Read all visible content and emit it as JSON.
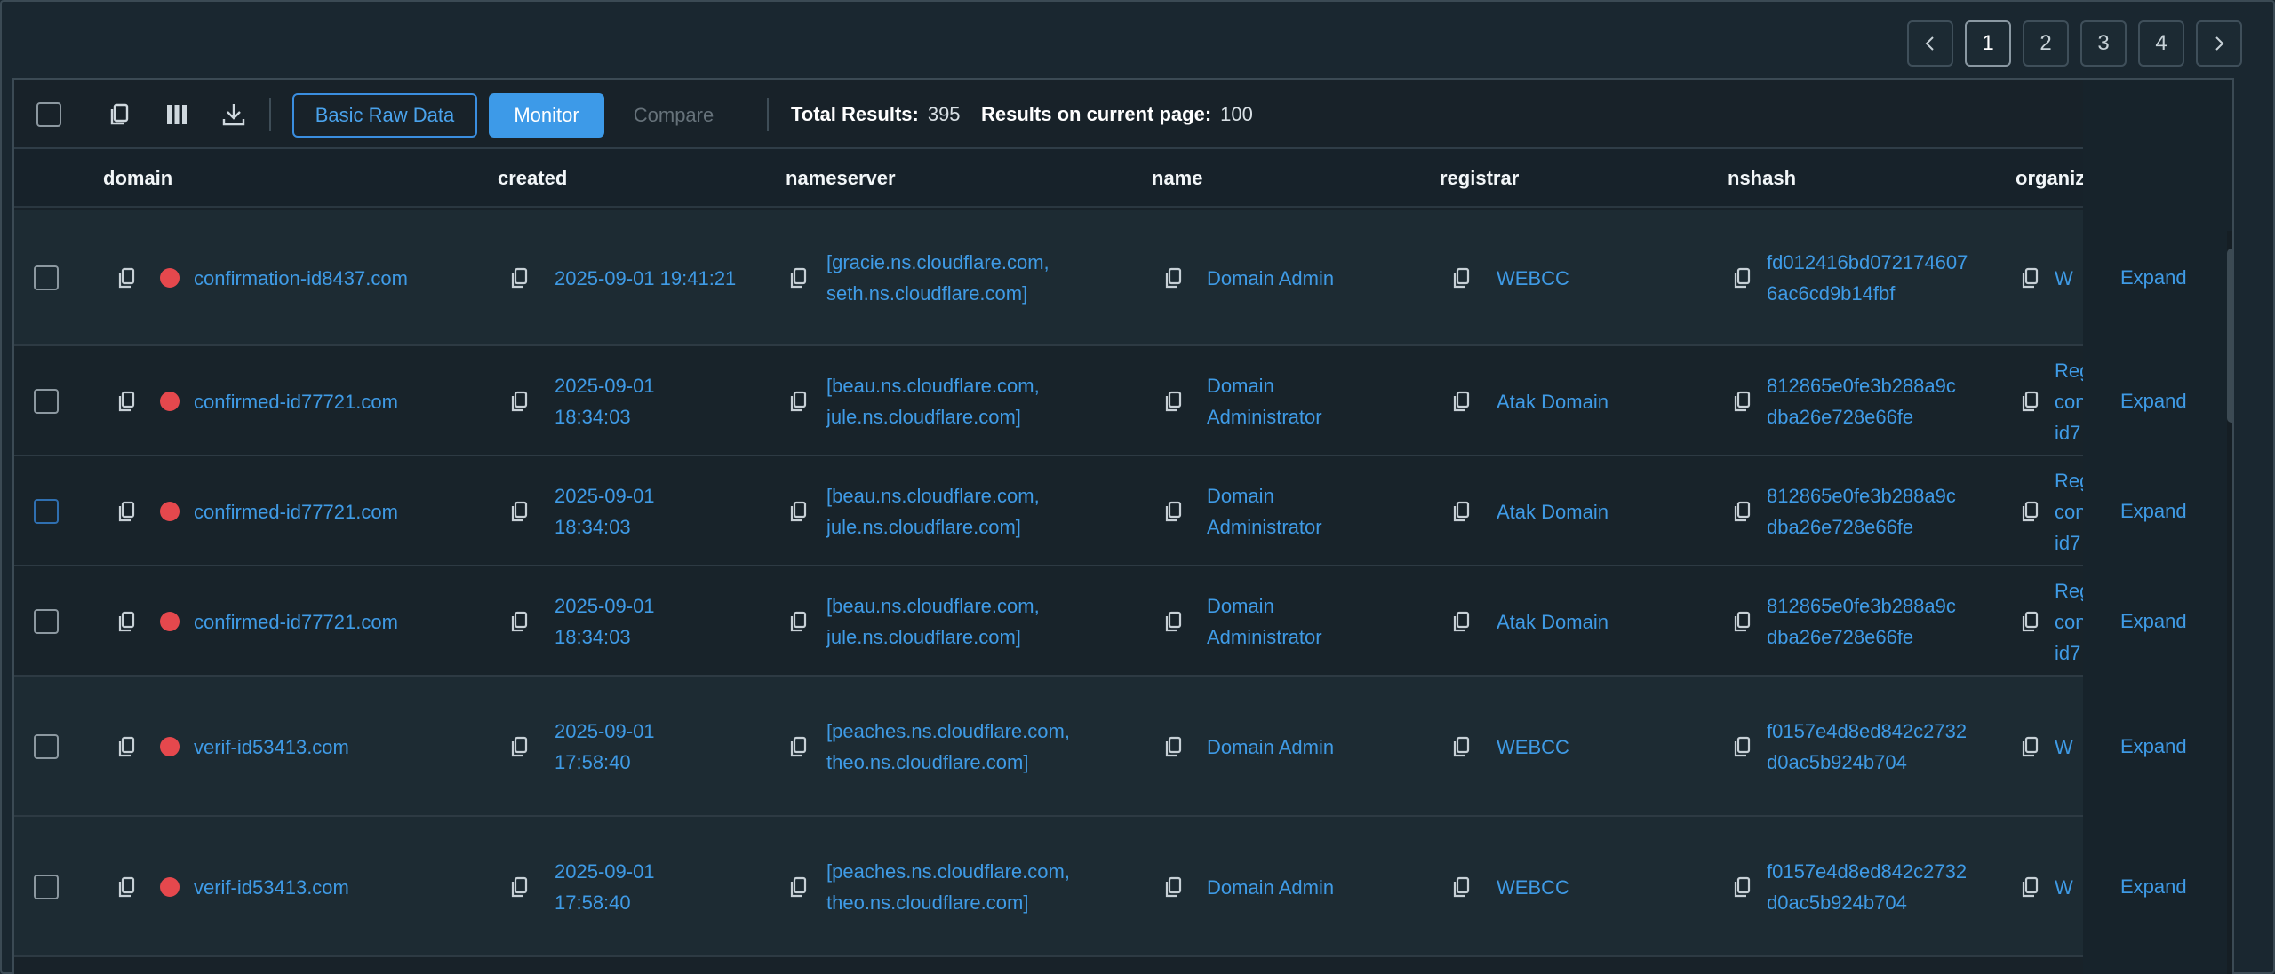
{
  "pagination": {
    "pages": [
      "1",
      "2",
      "3",
      "4"
    ],
    "active": "1"
  },
  "toolbar": {
    "basic_raw_data": "Basic Raw Data",
    "monitor": "Monitor",
    "compare": "Compare",
    "total_results_label": "Total Results:",
    "total_results": "395",
    "results_page_label": "Results on current page:",
    "results_page": "100",
    "save_to": "Save to"
  },
  "columns": [
    "domain",
    "created",
    "nameserver",
    "name",
    "registrar",
    "nshash",
    "organiz"
  ],
  "rows": [
    {
      "domain": "confirmation-id8437.com",
      "created": [
        "2025-09-01 19:41:21"
      ],
      "nameserver": [
        "[gracie.ns.cloudflare.com,",
        "seth.ns.cloudflare.com]"
      ],
      "name": [
        "Domain Admin"
      ],
      "registrar": "WEBCC",
      "nshash": [
        "fd012416bd072174607",
        "6ac6cd9b14fbf"
      ],
      "org": [
        "W"
      ],
      "expand": "Expand"
    },
    {
      "domain": "confirmed-id77721.com",
      "created": [
        "2025-09-01",
        "18:34:03"
      ],
      "nameserver": [
        "[beau.ns.cloudflare.com,",
        "jule.ns.cloudflare.com]"
      ],
      "name": [
        "Domain",
        "Administrator"
      ],
      "registrar": "Atak Domain",
      "nshash": [
        "812865e0fe3b288a9c",
        "dba26e728e66fe"
      ],
      "org": [
        "Reg",
        "con",
        "id7"
      ],
      "expand": "Expand"
    },
    {
      "domain": "confirmed-id77721.com",
      "created": [
        "2025-09-01",
        "18:34:03"
      ],
      "nameserver": [
        "[beau.ns.cloudflare.com,",
        "jule.ns.cloudflare.com]"
      ],
      "name": [
        "Domain",
        "Administrator"
      ],
      "registrar": "Atak Domain",
      "nshash": [
        "812865e0fe3b288a9c",
        "dba26e728e66fe"
      ],
      "org": [
        "Reg",
        "con",
        "id7"
      ],
      "expand": "Expand"
    },
    {
      "domain": "confirmed-id77721.com",
      "created": [
        "2025-09-01",
        "18:34:03"
      ],
      "nameserver": [
        "[beau.ns.cloudflare.com,",
        "jule.ns.cloudflare.com]"
      ],
      "name": [
        "Domain",
        "Administrator"
      ],
      "registrar": "Atak Domain",
      "nshash": [
        "812865e0fe3b288a9c",
        "dba26e728e66fe"
      ],
      "org": [
        "Reg",
        "con",
        "id7"
      ],
      "expand": "Expand"
    },
    {
      "domain": "verif-id53413.com",
      "created": [
        "2025-09-01",
        "17:58:40"
      ],
      "nameserver": [
        "[peaches.ns.cloudflare.com,",
        "theo.ns.cloudflare.com]"
      ],
      "name": [
        "Domain Admin"
      ],
      "registrar": "WEBCC",
      "nshash": [
        "f0157e4d8ed842c2732",
        "d0ac5b924b704"
      ],
      "org": [
        "W"
      ],
      "expand": "Expand"
    },
    {
      "domain": "verif-id53413.com",
      "created": [
        "2025-09-01",
        "17:58:40"
      ],
      "nameserver": [
        "[peaches.ns.cloudflare.com,",
        "theo.ns.cloudflare.com]"
      ],
      "name": [
        "Domain Admin"
      ],
      "registrar": "WEBCC",
      "nshash": [
        "f0157e4d8ed842c2732",
        "d0ac5b924b704"
      ],
      "org": [
        "W"
      ],
      "expand": "Expand"
    }
  ]
}
